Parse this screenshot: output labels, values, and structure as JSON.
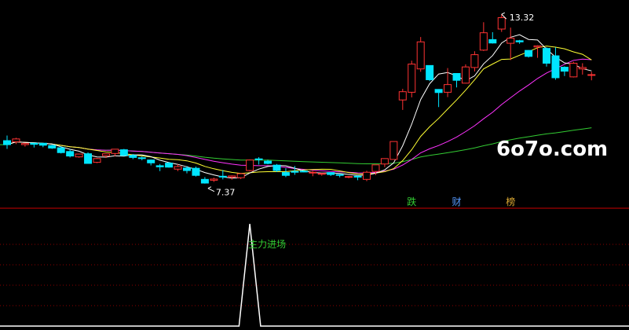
{
  "watermark": "6o7o.com",
  "chart_data": {
    "type": "candlestick",
    "price_range": [
      6.7,
      13.6
    ],
    "labels": {
      "high": "13.32",
      "low": "7.37",
      "high_value": 13.32,
      "low_value": 7.37
    },
    "badges": [
      {
        "text": "跌",
        "index": 45,
        "color": "#33cc33"
      },
      {
        "text": "财",
        "index": 50,
        "color": "#5599ff"
      },
      {
        "text": "榜",
        "index": 56,
        "color": "#ddaa33"
      }
    ],
    "colors": {
      "up": "#ff3333",
      "down": "#00e5ff",
      "ma5": "#ffffff",
      "ma10": "#ffff33",
      "ma20": "#ff33ff",
      "ma60": "#33cc33",
      "divider": "#cc0000",
      "grid": "#8b0000"
    },
    "candles": [
      [
        8.88,
        8.74,
        8.59,
        9.06
      ],
      [
        8.84,
        8.94,
        8.76,
        8.98
      ],
      [
        8.74,
        8.78,
        8.67,
        8.8
      ],
      [
        8.79,
        8.75,
        8.64,
        8.78
      ],
      [
        8.79,
        8.72,
        8.65,
        8.8
      ],
      [
        8.71,
        8.62,
        8.59,
        8.74
      ],
      [
        8.63,
        8.46,
        8.43,
        8.68
      ],
      [
        8.5,
        8.34,
        8.29,
        8.58
      ],
      [
        8.31,
        8.41,
        8.28,
        8.42
      ],
      [
        8.42,
        8.08,
        8.07,
        8.47
      ],
      [
        8.12,
        8.25,
        8.09,
        8.27
      ],
      [
        8.35,
        8.42,
        8.27,
        8.42
      ],
      [
        8.43,
        8.58,
        8.33,
        8.59
      ],
      [
        8.56,
        8.36,
        8.34,
        8.59
      ],
      [
        8.36,
        8.29,
        8.23,
        8.41
      ],
      [
        8.28,
        8.25,
        8.19,
        8.32
      ],
      [
        8.2,
        8.1,
        8.01,
        8.22
      ],
      [
        8.0,
        7.96,
        7.81,
        8.06
      ],
      [
        8.09,
        7.95,
        7.93,
        8.13
      ],
      [
        7.88,
        7.97,
        7.81,
        8.05
      ],
      [
        7.92,
        7.83,
        7.73,
        7.99
      ],
      [
        7.91,
        7.66,
        7.62,
        7.97
      ],
      [
        7.52,
        7.39,
        7.37,
        7.6
      ],
      [
        7.49,
        7.53,
        7.43,
        7.58
      ],
      [
        7.63,
        7.62,
        7.52,
        7.85
      ],
      [
        7.6,
        7.64,
        7.51,
        7.66
      ],
      [
        7.58,
        7.72,
        7.53,
        7.75
      ],
      [
        7.83,
        8.2,
        7.8,
        8.22
      ],
      [
        8.24,
        8.22,
        8.04,
        8.3
      ],
      [
        8.16,
        8.08,
        8.05,
        8.21
      ],
      [
        8.02,
        7.83,
        7.78,
        8.06
      ],
      [
        7.76,
        7.66,
        7.6,
        7.91
      ],
      [
        7.8,
        7.77,
        7.68,
        7.99
      ],
      [
        7.81,
        7.78,
        7.77,
        7.84
      ],
      [
        7.77,
        7.77,
        7.63,
        7.82
      ],
      [
        7.7,
        7.73,
        7.65,
        7.74
      ],
      [
        7.76,
        7.69,
        7.64,
        7.76
      ],
      [
        7.69,
        7.66,
        7.59,
        7.7
      ],
      [
        7.6,
        7.62,
        7.56,
        7.64
      ],
      [
        7.63,
        7.6,
        7.49,
        7.66
      ],
      [
        7.52,
        7.77,
        7.46,
        7.82
      ],
      [
        7.8,
        8.03,
        7.67,
        8.03
      ],
      [
        8.06,
        8.25,
        7.95,
        8.26
      ],
      [
        8.22,
        8.85,
        8.22,
        8.85
      ],
      [
        10.31,
        10.6,
        9.96,
        10.7
      ],
      [
        10.58,
        11.57,
        10.4,
        11.69
      ],
      [
        11.4,
        12.35,
        11.3,
        12.52
      ],
      [
        11.52,
        11.02,
        10.97,
        11.53
      ],
      [
        10.68,
        10.57,
        10.06,
        10.69
      ],
      [
        10.58,
        10.85,
        10.41,
        11.43
      ],
      [
        11.24,
        11.0,
        10.75,
        11.02
      ],
      [
        10.9,
        11.47,
        10.89,
        11.56
      ],
      [
        11.45,
        11.9,
        11.31,
        12.02
      ],
      [
        12.06,
        12.67,
        12.03,
        13.04
      ],
      [
        12.43,
        12.31,
        12.29,
        12.69
      ],
      [
        12.8,
        13.2,
        12.7,
        13.32
      ],
      [
        12.3,
        12.48,
        11.71,
        12.85
      ],
      [
        12.39,
        12.35,
        12.28,
        12.42
      ],
      [
        12.05,
        11.84,
        11.8,
        12.06
      ],
      [
        12.17,
        12.21,
        11.79,
        12.23
      ],
      [
        12.12,
        11.6,
        11.48,
        12.16
      ],
      [
        11.86,
        11.09,
        11.02,
        12.16
      ],
      [
        11.46,
        11.32,
        11.15,
        11.49
      ],
      [
        11.12,
        11.6,
        11.1,
        11.65
      ],
      [
        11.4,
        11.45,
        11.2,
        11.6
      ],
      [
        11.2,
        11.2,
        11.0,
        11.3
      ]
    ],
    "indicator": {
      "name": "主力进场",
      "values": [
        0,
        0,
        0,
        0,
        0,
        0,
        0,
        0,
        0,
        0,
        0,
        0,
        0,
        0,
        0,
        0,
        0,
        0,
        0,
        0,
        0,
        0,
        0,
        0,
        0,
        0,
        0,
        1,
        0,
        0,
        0,
        0,
        0,
        0,
        0,
        0,
        0,
        0,
        0,
        0,
        0,
        0,
        0,
        0,
        0,
        0,
        0,
        0,
        0,
        0,
        0,
        0,
        0,
        0,
        0,
        0,
        0,
        0,
        0,
        0,
        0,
        0,
        0,
        0,
        0,
        0
      ],
      "signal_index": 27,
      "color": "#33cc33"
    }
  }
}
